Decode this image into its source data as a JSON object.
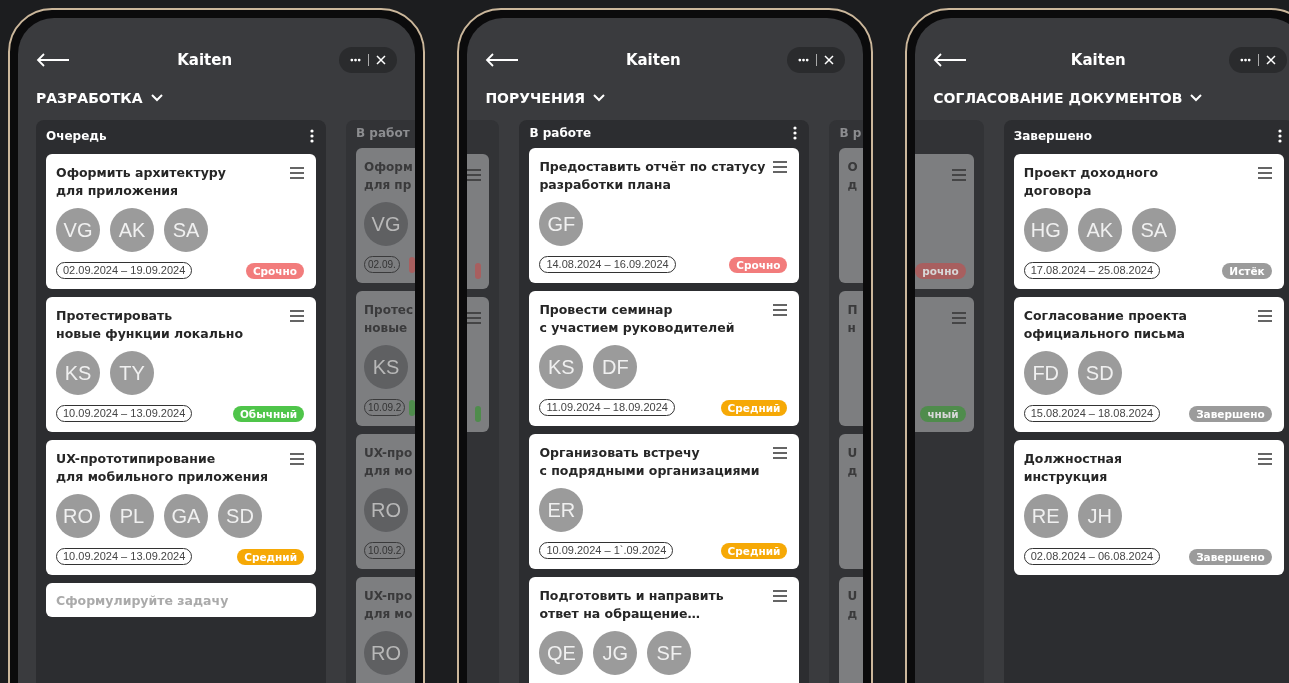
{
  "phones": [
    {
      "app_title": "Kaiten",
      "board": "РАЗРАБОТКА",
      "columns": [
        {
          "kind": "main",
          "title": "Очередь",
          "cards": [
            {
              "title": "Оформить архитектуру\nдля приложения",
              "avatars": [
                "VG",
                "AK",
                "SA"
              ],
              "dates": "02.09.2024 – 19.09.2024",
              "badge": {
                "label": "Срочно",
                "color": "#f27c7c"
              }
            },
            {
              "title": "Протестировать\nновые функции локально",
              "avatars": [
                "KS",
                "TY"
              ],
              "dates": "10.09.2024 – 13.09.2024",
              "badge": {
                "label": "Обычный",
                "color": "#4fc54a"
              }
            },
            {
              "title": "UX-прототипирование\nдля мобильного приложения",
              "avatars": [
                "RO",
                "PL",
                "GA",
                "SD"
              ],
              "dates": "10.09.2024 – 13.09.2024",
              "badge": {
                "label": "Средний",
                "color": "#f6a906"
              }
            }
          ],
          "add_placeholder": "Сформулируйте задачу"
        },
        {
          "kind": "peek-right",
          "title": "В работ",
          "cards": [
            {
              "title": "Оформ\nдля пр",
              "avatars": [
                "VG"
              ],
              "dates": "02.09.",
              "badge": {
                "color": "#a85f5f"
              }
            },
            {
              "title": "Протес\nновые",
              "avatars": [
                "KS"
              ],
              "dates": "10.09.2",
              "badge": {
                "color": "#4f8c4c"
              }
            },
            {
              "title": "UX-про\nдля мо",
              "avatars": [
                "RO"
              ],
              "dates": "10.09.2"
            },
            {
              "title": "UX-про\nдля мо",
              "avatars": [
                "RO"
              ]
            }
          ]
        }
      ]
    },
    {
      "app_title": "Kaiten",
      "board": "ПОРУЧЕНИЯ",
      "columns": [
        {
          "kind": "peek-left",
          "cards": [
            {
              "badge": {
                "color": "#a85f5f"
              }
            },
            {
              "badge": {
                "color": "#4f8c4c"
              }
            }
          ]
        },
        {
          "kind": "main",
          "title": "В работе",
          "cards": [
            {
              "title": "Предоставить отчёт по статусу\nразработки плана",
              "avatars": [
                "GF"
              ],
              "dates": "14.08.2024 – 16.09.2024",
              "badge": {
                "label": "Срочно",
                "color": "#f27c7c"
              }
            },
            {
              "title": "Провести семинар\nс участием руководителей",
              "avatars": [
                "KS",
                "DF"
              ],
              "dates": "11.09.2024 – 18.09.2024",
              "badge": {
                "label": "Средний",
                "color": "#f6a906"
              }
            },
            {
              "title": "Организовать встречу\nс подрядными организациями",
              "avatars": [
                "ER"
              ],
              "dates": "10.09.2024 – 1`.09.2024",
              "badge": {
                "label": "Средний",
                "color": "#f6a906"
              }
            },
            {
              "title": "Подготовить и направить\nответ на обращение…",
              "avatars": [
                "QE",
                "JG",
                "SF"
              ]
            }
          ]
        },
        {
          "kind": "peek-right",
          "title": "В р",
          "cards": [
            {
              "title": "О\nд"
            },
            {
              "title": "П\nн"
            },
            {
              "title": "U\nд"
            },
            {
              "title": "U\nд"
            }
          ]
        }
      ]
    },
    {
      "app_title": "Kaiten",
      "board": "СОГЛАСОВАНИЕ ДОКУМЕНТОВ",
      "columns": [
        {
          "kind": "peek-left",
          "cards": [
            {
              "badge": {
                "label": "рочно",
                "color": "#a85f5f"
              }
            },
            {
              "badge": {
                "label": "чный",
                "color": "#4f8c4c"
              }
            }
          ]
        },
        {
          "kind": "main",
          "title": "Завершено",
          "cards": [
            {
              "title": "Проект доходного\nдоговора",
              "avatars": [
                "HG",
                "AK",
                "SA"
              ],
              "dates": "17.08.2024 – 25.08.2024",
              "badge": {
                "label": "Истёк",
                "color": "#9b9b9b"
              }
            },
            {
              "title": "Согласование проекта\nофициального письма",
              "avatars": [
                "FD",
                "SD"
              ],
              "dates": "15.08.2024 – 18.08.2024",
              "badge": {
                "label": "Завершено",
                "color": "#9b9b9b"
              }
            },
            {
              "title": "Должностная\nинструкция",
              "avatars": [
                "RE",
                "JH"
              ],
              "dates": "02.08.2024 – 06.08.2024",
              "badge": {
                "label": "Завершено",
                "color": "#9b9b9b"
              }
            }
          ]
        }
      ]
    }
  ]
}
